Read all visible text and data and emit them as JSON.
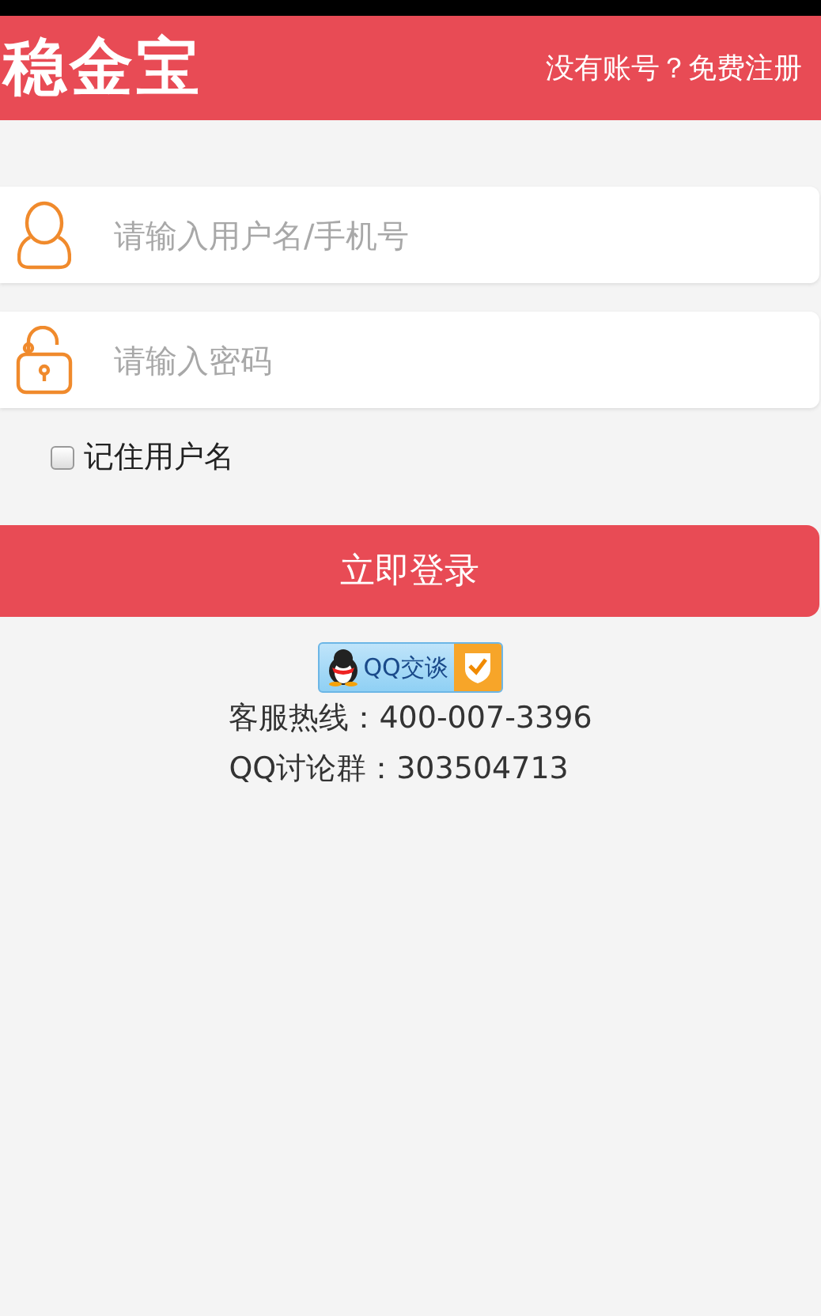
{
  "header": {
    "logo": "稳金宝",
    "register_link": "没有账号？免费注册"
  },
  "fields": [
    {
      "kind": "user",
      "placeholder": "请输入用户名/手机号"
    },
    {
      "kind": "password",
      "placeholder": "请输入密码"
    }
  ],
  "remember": {
    "label": "记住用户名",
    "checked": false
  },
  "login_button": "立即登录",
  "qq_badge": "QQ交谈",
  "contact": [
    "客服热线：400-007-3396",
    "QQ讨论群：303504713"
  ]
}
